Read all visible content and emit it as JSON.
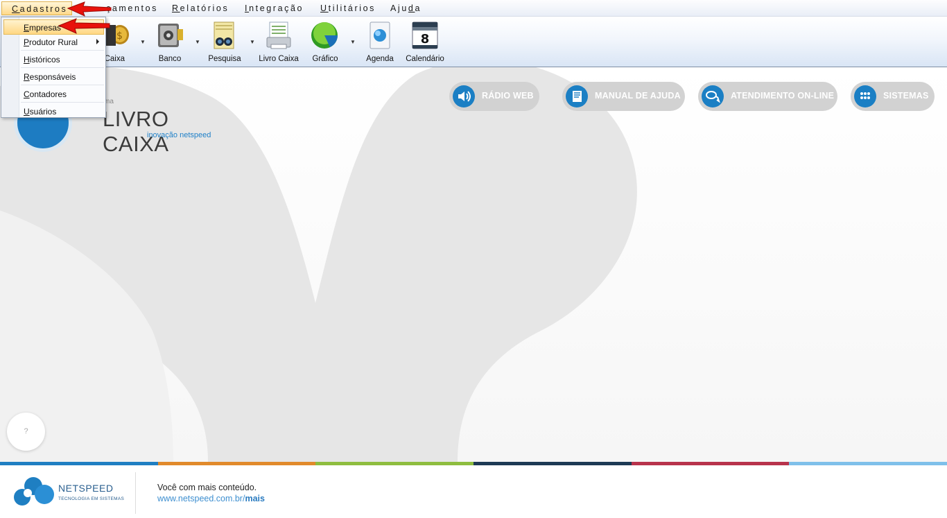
{
  "menubar": {
    "items": [
      {
        "label": "Cadastros",
        "accel": "C"
      },
      {
        "label": "Lançamentos",
        "accel": "L"
      },
      {
        "label": "Relatórios",
        "accel": "R"
      },
      {
        "label": "Integração",
        "accel": "I"
      },
      {
        "label": "Utilitários",
        "accel": "U"
      },
      {
        "label": "Ajuda",
        "accel": "d"
      }
    ],
    "menu1_rest": "adastros",
    "menu2_visible": "çamentos",
    "menu3_rest": "elatórios",
    "menu4_rest": "ntegração",
    "menu5_rest": "tilitários",
    "menu6_pre": "Aju",
    "menu6_post": "a"
  },
  "cadastros_menu": {
    "items": [
      {
        "label": "Empresas",
        "accel": "E"
      },
      {
        "label": "Produtor Rural",
        "accel": "P",
        "has_submenu": true
      },
      {
        "label": "Históricos",
        "accel": "H"
      },
      {
        "label": "Responsáveis",
        "accel": "R"
      },
      {
        "label": "Contadores",
        "accel": "C"
      },
      {
        "label": "Usuários",
        "accel": "U"
      }
    ]
  },
  "toolbar": {
    "items": [
      {
        "label": "Caixa",
        "icon": "coins-icon"
      },
      {
        "label": "Banco",
        "icon": "safe-icon"
      },
      {
        "label": "Pesquisa",
        "icon": "binoculars-icon"
      },
      {
        "label": "Livro Caixa",
        "icon": "printer-icon"
      },
      {
        "label": "Gráfico",
        "icon": "pie-chart-icon"
      },
      {
        "label": "Agenda",
        "icon": "agenda-globe-icon"
      },
      {
        "label": "Calendário",
        "icon": "calendar-icon"
      }
    ],
    "calendar_day": "8"
  },
  "brand": {
    "small_text": "ma",
    "title": "LIVRO CAIXA",
    "subtitle": "inovação netspeed"
  },
  "quick_links": [
    {
      "label": "RÁDIO WEB",
      "icon": "speaker-icon"
    },
    {
      "label": "MANUAL DE AJUDA",
      "icon": "book-icon"
    },
    {
      "label": "ATENDIMENTO ON-LINE",
      "icon": "chat-icon"
    },
    {
      "label": "SISTEMAS",
      "icon": "grid-dots-icon"
    }
  ],
  "help_bubble": "?",
  "footer": {
    "company": "NETSPEED",
    "tagline": "TECNOLOGIA EM SISTEMAS",
    "line1": "Você com mais conteúdo.",
    "url_prefix": "www.netspeed.com.br/",
    "url_suffix": "mais",
    "stripe_colors": [
      "#1f7fc2",
      "#e18a2b",
      "#8ebd3f",
      "#1e3a55",
      "#b8334c",
      "#7fc0ea"
    ]
  },
  "colors": {
    "accent": "#1b7fc4",
    "pill_bg": "#d2d2d2",
    "annotation_arrow": "#e8120c"
  }
}
